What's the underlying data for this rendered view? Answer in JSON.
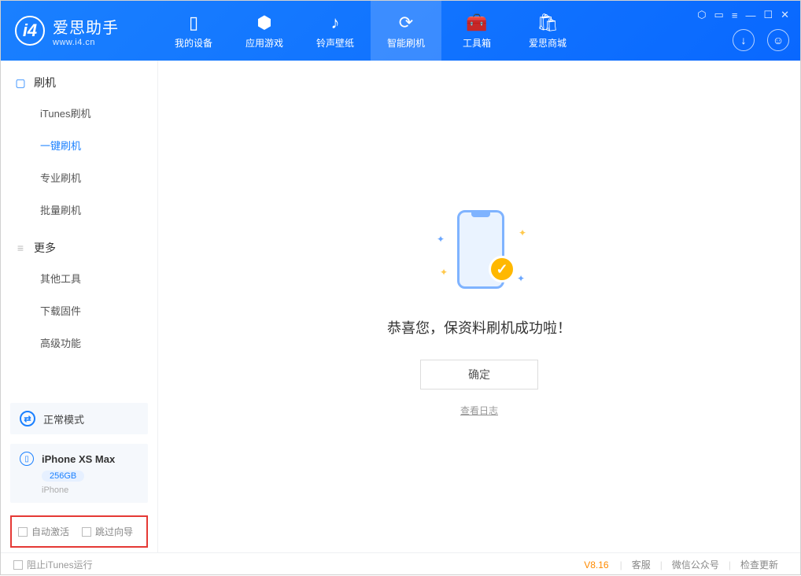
{
  "app": {
    "name": "爱思助手",
    "url": "www.i4.cn"
  },
  "nav": {
    "tabs": [
      {
        "label": "我的设备",
        "icon": "▯"
      },
      {
        "label": "应用游戏",
        "icon": "⬢"
      },
      {
        "label": "铃声壁纸",
        "icon": "♪"
      },
      {
        "label": "智能刷机",
        "icon": "⟳"
      },
      {
        "label": "工具箱",
        "icon": "🧰"
      },
      {
        "label": "爱思商城",
        "icon": "🛍"
      }
    ]
  },
  "sidebar": {
    "sections": [
      {
        "title": "刷机",
        "icon": "▢",
        "items": [
          "iTunes刷机",
          "一键刷机",
          "专业刷机",
          "批量刷机"
        ]
      },
      {
        "title": "更多",
        "icon": "≡",
        "items": [
          "其他工具",
          "下载固件",
          "高级功能"
        ]
      }
    ],
    "mode": {
      "label": "正常模式"
    },
    "device": {
      "name": "iPhone XS Max",
      "storage": "256GB",
      "type": "iPhone"
    },
    "options": {
      "auto_activate": "自动激活",
      "skip_guide": "跳过向导"
    }
  },
  "main": {
    "success_text": "恭喜您，保资料刷机成功啦！",
    "ok_label": "确定",
    "log_label": "查看日志"
  },
  "footer": {
    "block_itunes": "阻止iTunes运行",
    "version": "V8.16",
    "links": [
      "客服",
      "微信公众号",
      "检查更新"
    ]
  }
}
